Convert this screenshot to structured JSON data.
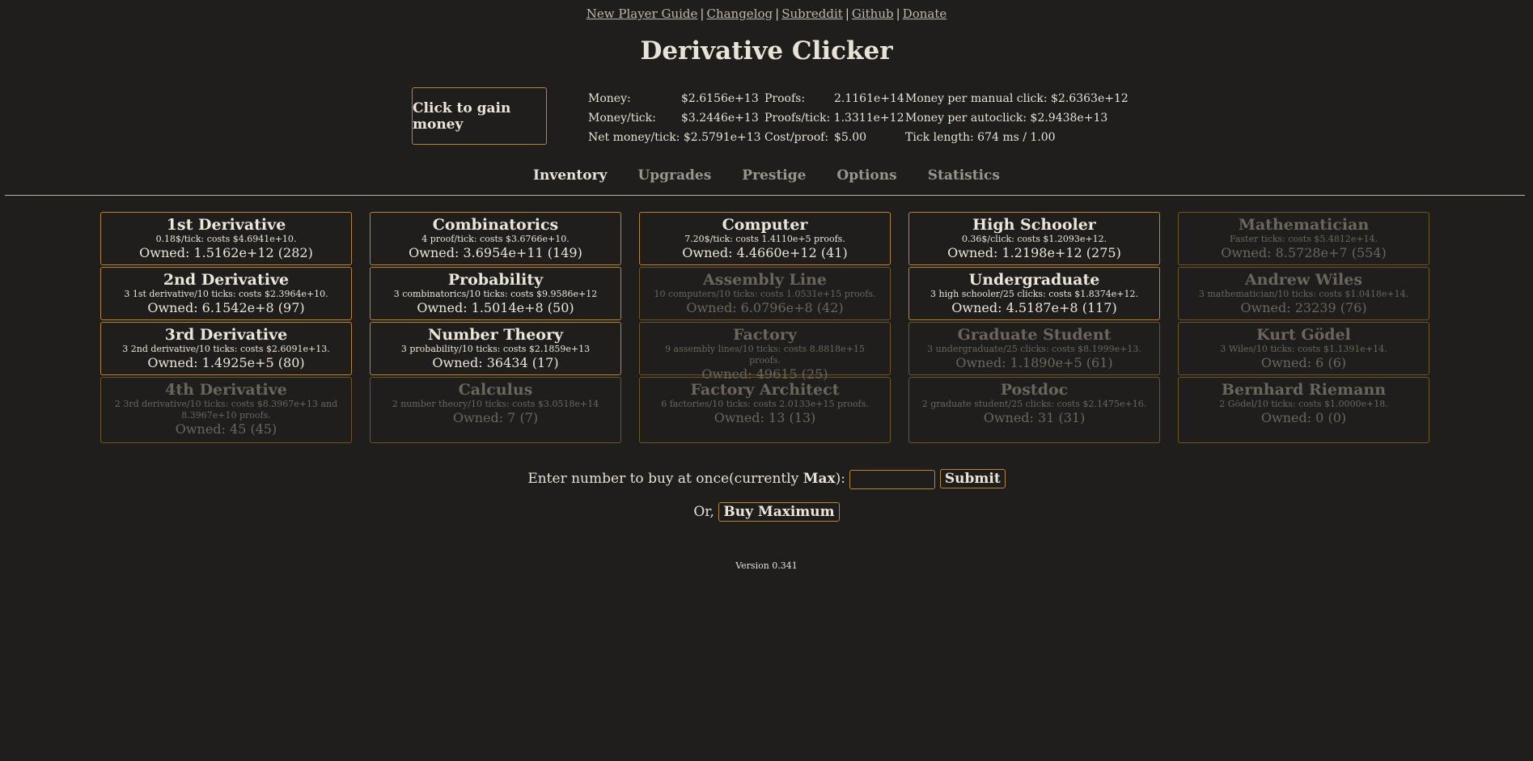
{
  "links": [
    "New Player Guide",
    "Changelog",
    "Subreddit",
    "Github",
    "Donate"
  ],
  "separator": "|",
  "title": "Derivative Clicker",
  "click_button": "Click to gain money",
  "stats": {
    "col1": [
      {
        "label": "Money:",
        "value": "$2.6156e+13"
      },
      {
        "label": "Money/tick:",
        "value": "$3.2446e+13"
      },
      {
        "label": "Net money/tick:",
        "value": "$2.5791e+13"
      }
    ],
    "col2": [
      {
        "label": "Proofs:",
        "value": "2.1161e+14"
      },
      {
        "label": "Proofs/tick:",
        "value": "1.3311e+12"
      },
      {
        "label": "Cost/proof:",
        "value": "$5.00"
      }
    ],
    "col3": [
      {
        "label": "Money per manual click:",
        "value": "$2.6363e+12"
      },
      {
        "label": "Money per autoclick:",
        "value": "$2.9438e+13"
      },
      {
        "label": "Tick length:",
        "value": "674 ms / 1.00"
      }
    ]
  },
  "tabs": [
    "Inventory",
    "Upgrades",
    "Prestige",
    "Options",
    "Statistics"
  ],
  "active_tab": "Inventory",
  "columns": [
    [
      {
        "name": "1st Derivative",
        "desc": "0.18$/tick: costs $4.6941e+10.",
        "owned": "Owned: 1.5162e+12 (282)",
        "enabled": true
      },
      {
        "name": "2nd Derivative",
        "desc": "3 1st derivative/10 ticks: costs $2.3964e+10.",
        "owned": "Owned: 6.1542e+8 (97)",
        "enabled": true
      },
      {
        "name": "3rd Derivative",
        "desc": "3 2nd derivative/10 ticks: costs $2.6091e+13.",
        "owned": "Owned: 1.4925e+5 (80)",
        "enabled": true
      },
      {
        "name": "4th Derivative",
        "desc": "2 3rd derivative/10 ticks: costs $8.3967e+13 and 8.3967e+10 proofs.",
        "owned": "Owned: 45 (45)",
        "enabled": false
      }
    ],
    [
      {
        "name": "Combinatorics",
        "desc": "4 proof/tick: costs $3.6766e+10.",
        "owned": "Owned: 3.6954e+11 (149)",
        "enabled": true
      },
      {
        "name": "Probability",
        "desc": "3 combinatorics/10 ticks: costs $9.9586e+12",
        "owned": "Owned: 1.5014e+8 (50)",
        "enabled": true
      },
      {
        "name": "Number Theory",
        "desc": "3 probability/10 ticks: costs $2.1859e+13",
        "owned": "Owned: 36434 (17)",
        "enabled": true
      },
      {
        "name": "Calculus",
        "desc": "2 number theory/10 ticks: costs $3.0518e+14",
        "owned": "Owned: 7 (7)",
        "enabled": false
      }
    ],
    [
      {
        "name": "Computer",
        "desc": "7.20$/tick: costs 1.4110e+5 proofs.",
        "owned": "Owned: 4.4660e+12 (41)",
        "enabled": true
      },
      {
        "name": "Assembly Line",
        "desc": "10 computers/10 ticks: costs 1.0531e+15 proofs.",
        "owned": "Owned: 6.0796e+8 (42)",
        "enabled": false
      },
      {
        "name": "Factory",
        "desc": "9 assembly lines/10 ticks: costs 8.8818e+15 proofs.",
        "owned": "Owned: 49615 (25)",
        "enabled": false
      },
      {
        "name": "Factory Architect",
        "desc": "6 factories/10 ticks: costs 2.0133e+15 proofs.",
        "owned": "Owned: 13 (13)",
        "enabled": false
      }
    ],
    [
      {
        "name": "High Schooler",
        "desc": "0.36$/click: costs $1.2093e+12.",
        "owned": "Owned: 1.2198e+12 (275)",
        "enabled": true
      },
      {
        "name": "Undergraduate",
        "desc": "3 high schooler/25 clicks: costs $1.8374e+12.",
        "owned": "Owned: 4.5187e+8 (117)",
        "enabled": true
      },
      {
        "name": "Graduate Student",
        "desc": "3 undergraduate/25 clicks: costs $8.1999e+13.",
        "owned": "Owned: 1.1890e+5 (61)",
        "enabled": false
      },
      {
        "name": "Postdoc",
        "desc": "2 graduate student/25 clicks: costs $2.1475e+16.",
        "owned": "Owned: 31 (31)",
        "enabled": false
      }
    ],
    [
      {
        "name": "Mathematician",
        "desc": "Faster ticks: costs $5.4812e+14.",
        "owned": "Owned: 8.5728e+7 (554)",
        "enabled": false
      },
      {
        "name": "Andrew Wiles",
        "desc": "3 mathematician/10 ticks: costs $1.0418e+14.",
        "owned": "Owned: 23239 (76)",
        "enabled": false
      },
      {
        "name": "Kurt Gödel",
        "desc": "3 Wiles/10 ticks: costs $1.1391e+14.",
        "owned": "Owned: 6 (6)",
        "enabled": false
      },
      {
        "name": "Bernhard Riemann",
        "desc": "2 Gödel/10 ticks: costs $1.0000e+18.",
        "owned": "Owned: 0 (0)",
        "enabled": false
      }
    ]
  ],
  "buy": {
    "prefix": "Enter number to buy at once(currently ",
    "current": "Max",
    "suffix": "):",
    "input_value": "",
    "submit": "Submit",
    "or_label": "Or,",
    "max_button": "Buy Maximum"
  },
  "version": "Version 0.341",
  "colors": {
    "accent": "#b8862c",
    "background": "#1f1e1c",
    "text": "#e6e1d6",
    "dim_text": "#6a665e"
  }
}
